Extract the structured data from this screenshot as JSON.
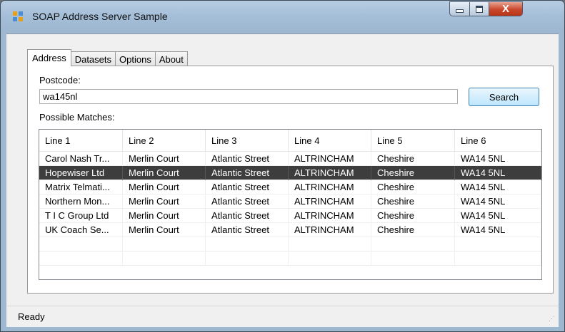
{
  "window": {
    "title": "SOAP Address Server Sample",
    "controls": {
      "minimize": "minimize",
      "maximize": "maximize",
      "close": "X"
    }
  },
  "tabs": [
    {
      "label": "Address",
      "active": true
    },
    {
      "label": "Datasets",
      "active": false
    },
    {
      "label": "Options",
      "active": false
    },
    {
      "label": "About",
      "active": false
    }
  ],
  "form": {
    "postcode_label": "Postcode:",
    "postcode_value": "wa145nl",
    "search_label": "Search",
    "matches_label": "Possible Matches:"
  },
  "table": {
    "columns": [
      "Line 1",
      "Line 2",
      "Line 3",
      "Line 4",
      "Line 5",
      "Line 6"
    ],
    "rows": [
      [
        "Carol Nash Tr...",
        "Merlin Court",
        "Atlantic Street",
        "ALTRINCHAM",
        "Cheshire",
        "WA14 5NL"
      ],
      [
        "Hopewiser Ltd",
        "Merlin Court",
        "Atlantic Street",
        "ALTRINCHAM",
        "Cheshire",
        "WA14 5NL"
      ],
      [
        "Matrix Telmati...",
        "Merlin Court",
        "Atlantic Street",
        "ALTRINCHAM",
        "Cheshire",
        "WA14 5NL"
      ],
      [
        "Northern Mon...",
        "Merlin Court",
        "Atlantic Street",
        "ALTRINCHAM",
        "Cheshire",
        "WA14 5NL"
      ],
      [
        "T I C Group Ltd",
        "Merlin Court",
        "Atlantic Street",
        "ALTRINCHAM",
        "Cheshire",
        "WA14 5NL"
      ],
      [
        "UK Coach Se...",
        "Merlin Court",
        "Atlantic Street",
        "ALTRINCHAM",
        "Cheshire",
        "WA14 5NL"
      ]
    ],
    "selected_row": 1
  },
  "status": {
    "text": "Ready"
  },
  "colors": {
    "selection": "#3d3d3d",
    "button_border": "#3c7fb1",
    "titlebar": "#a6bfd9"
  }
}
